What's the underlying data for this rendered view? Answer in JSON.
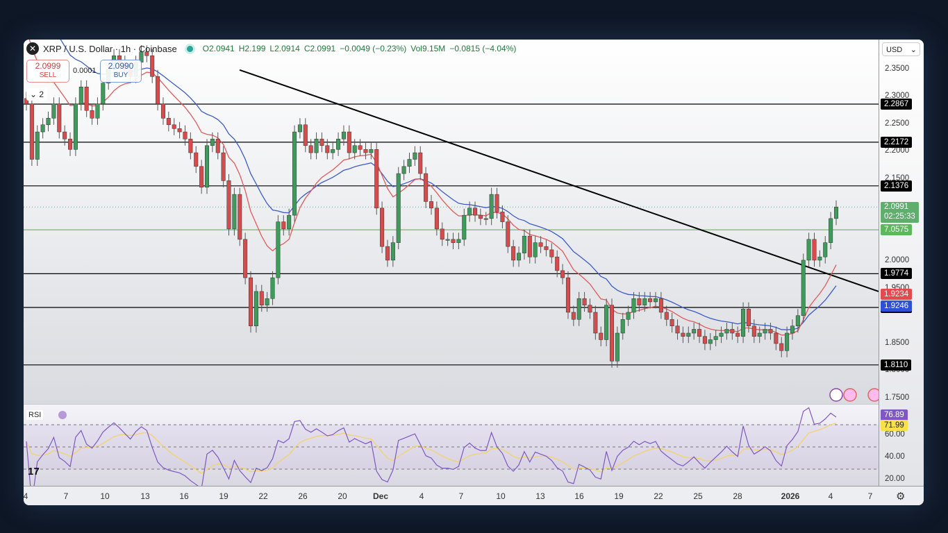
{
  "header": {
    "symbol": "XRP / U.S. Dollar · 1h · Coinbase",
    "open": "O2.0941",
    "high": "H2.199",
    "low": "L2.0914",
    "close": "C2.0991",
    "change": "−0.0049 (−0.23%)",
    "volume": "Vol9.15M",
    "vol_change": "−0.0815 (−4.04%)"
  },
  "trade": {
    "sell_price": "2.0999",
    "sell_label": "SELL",
    "spread": "0.0001",
    "buy_price": "2.0990",
    "buy_label": "BUY",
    "collapse_count": "2"
  },
  "currency": "USD",
  "rsi_label": "RSI",
  "colors": {
    "up": "#3f9a5c",
    "down": "#d64c4c",
    "ema_fast": "#e05a5a",
    "ema_slow": "#3a5bc7",
    "rsi": "#7e57c2",
    "rsi_ma": "#f3d36b",
    "support": "#000000",
    "green_level": "#4caf50"
  },
  "chart_data": {
    "type": "candlestick",
    "title": "XRP / U.S. Dollar · 1h · Coinbase",
    "ylim": [
      1.73,
      2.4
    ],
    "y_ticks": [
      "2.3500",
      "2.3000",
      "2.2500",
      "2.2000",
      "2.1500",
      "2.0500",
      "2.0000",
      "1.9500",
      "1.8500",
      "1.8000",
      "1.7500"
    ],
    "x_ticks": [
      "4",
      "7",
      "10",
      "13",
      "16",
      "19",
      "22",
      "26",
      "20",
      "Dec",
      "4",
      "7",
      "10",
      "13",
      "16",
      "19",
      "22",
      "25",
      "28",
      "2026",
      "4",
      "7"
    ],
    "closes": [
      2.287,
      2.186,
      2.236,
      2.249,
      2.261,
      2.287,
      2.236,
      2.223,
      2.204,
      2.287,
      2.318,
      2.275,
      2.261,
      2.287,
      2.325,
      2.35,
      2.375,
      2.363,
      2.35,
      2.337,
      2.363,
      2.382,
      2.375,
      2.337,
      2.287,
      2.261,
      2.249,
      2.242,
      2.236,
      2.223,
      2.198,
      2.173,
      2.135,
      2.211,
      2.223,
      2.198,
      2.147,
      2.059,
      2.122,
      2.04,
      1.97,
      1.882,
      1.945,
      1.92,
      1.932,
      1.97,
      2.072,
      2.059,
      2.084,
      2.236,
      2.249,
      2.211,
      2.198,
      2.223,
      2.211,
      2.198,
      2.204,
      2.223,
      2.236,
      2.198,
      2.211,
      2.204,
      2.198,
      2.204,
      2.097,
      2.027,
      2.002,
      2.034,
      2.16,
      2.173,
      2.186,
      2.198,
      2.16,
      2.109,
      2.097,
      2.059,
      2.04,
      2.04,
      2.034,
      2.04,
      2.084,
      2.097,
      2.084,
      2.078,
      2.078,
      2.122,
      2.09,
      2.072,
      2.027,
      2.002,
      2.015,
      2.046,
      2.008,
      2.034,
      2.027,
      2.021,
      2.008,
      1.983,
      1.97,
      1.907,
      1.894,
      1.932,
      1.92,
      1.907,
      1.869,
      1.857,
      1.92,
      1.818,
      1.869,
      1.894,
      1.907,
      1.932,
      1.92,
      1.932,
      1.926,
      1.932,
      1.907,
      1.894,
      1.882,
      1.869,
      1.863,
      1.869,
      1.876,
      1.863,
      1.85,
      1.857,
      1.863,
      1.869,
      1.876,
      1.869,
      1.863,
      1.913,
      1.882,
      1.863,
      1.869,
      1.876,
      1.869,
      1.85,
      1.837,
      1.869,
      1.882,
      1.901,
      2.002,
      2.04,
      2.002,
      2.008,
      2.034,
      2.078,
      2.099
    ],
    "levels": [
      {
        "value": 2.2867,
        "label": "2.2867"
      },
      {
        "value": 2.2172,
        "label": "2.2172"
      },
      {
        "value": 2.1376,
        "label": "2.1376"
      },
      {
        "value": 1.9774,
        "label": "1.9774"
      },
      {
        "value": 1.9158,
        "label": "1.9158"
      },
      {
        "value": 1.811,
        "label": "1.8110"
      }
    ],
    "green_level": {
      "value": 2.0575,
      "label": "7.0575"
    },
    "last_price": {
      "value": 2.0991,
      "label": "2.0991",
      "countdown": "02:25:33"
    },
    "ema_fast_last": "1.9234",
    "ema_slow_last": "1.9246",
    "trendline": {
      "from": 2.349,
      "to": 1.945
    },
    "rsi": {
      "ylim": [
        15,
        85
      ],
      "ticks": [
        "60.00",
        "40.00",
        "20.00"
      ],
      "bands": [
        70,
        50,
        30
      ],
      "last": "76.89",
      "ma_last": "71.99"
    }
  }
}
